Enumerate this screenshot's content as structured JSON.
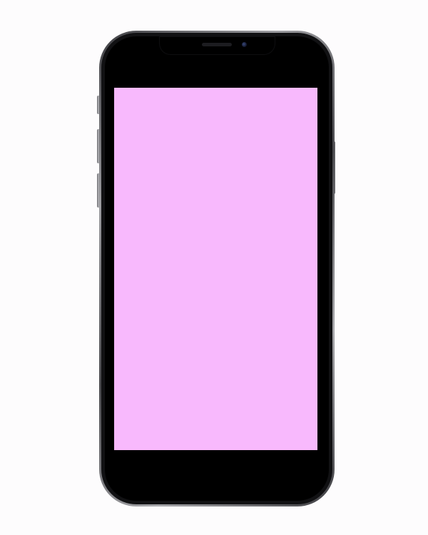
{
  "device": {
    "model": "smartphone-mockup",
    "frame_color": "#9d9da1",
    "bezel_color": "#000000",
    "screen_color": "#f8b9fd",
    "page_background": "#fdfcfd"
  },
  "screen": {
    "content": ""
  }
}
